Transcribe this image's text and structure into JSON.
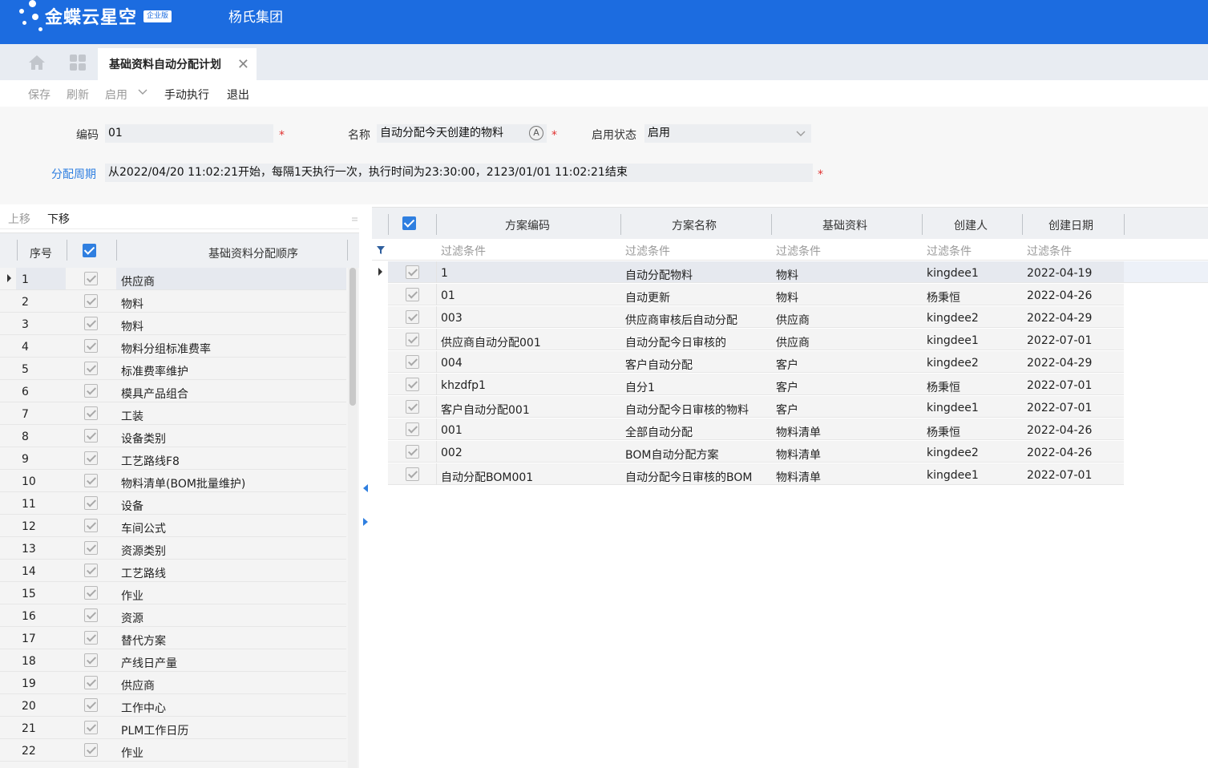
{
  "app": {
    "logo_text": "金蝶云星空",
    "logo_badge": "企业版",
    "company": "杨氏集团"
  },
  "tabs": {
    "active_label": "基础资料自动分配计划",
    "close_glyph": "✕"
  },
  "toolbar": {
    "save": "保存",
    "refresh": "刷新",
    "enable": "启用",
    "manual_run": "手动执行",
    "exit": "退出"
  },
  "form": {
    "code_label": "编码",
    "code_value": "01",
    "name_label": "名称",
    "name_value": "自动分配今天创建的物料",
    "status_label": "启用状态",
    "status_value": "启用",
    "period_label": "分配周期",
    "period_value": "从2022/04/20 11:02:21开始，每隔1天执行一次，执行时间为23:30:00，2123/01/01 11:02:21结束",
    "required_mark": "*",
    "multilang_glyph": "A"
  },
  "left": {
    "move_up": "上移",
    "move_down": "下移",
    "col_seq": "序号",
    "col_name": "基础资料分配顺序",
    "rows": [
      {
        "seq": "1",
        "name": "供应商"
      },
      {
        "seq": "2",
        "name": "物料"
      },
      {
        "seq": "3",
        "name": "物料"
      },
      {
        "seq": "4",
        "name": "物料分组标准费率"
      },
      {
        "seq": "5",
        "name": "标准费率维护"
      },
      {
        "seq": "6",
        "name": "模具产品组合"
      },
      {
        "seq": "7",
        "name": "工装"
      },
      {
        "seq": "8",
        "name": "设备类别"
      },
      {
        "seq": "9",
        "name": "工艺路线F8"
      },
      {
        "seq": "10",
        "name": "物料清单(BOM批量维护)"
      },
      {
        "seq": "11",
        "name": "设备"
      },
      {
        "seq": "12",
        "name": "车间公式"
      },
      {
        "seq": "13",
        "name": "资源类别"
      },
      {
        "seq": "14",
        "name": "工艺路线"
      },
      {
        "seq": "15",
        "name": "作业"
      },
      {
        "seq": "16",
        "name": "资源"
      },
      {
        "seq": "17",
        "name": "替代方案"
      },
      {
        "seq": "18",
        "name": "产线日产量"
      },
      {
        "seq": "19",
        "name": "供应商"
      },
      {
        "seq": "20",
        "name": "工作中心"
      },
      {
        "seq": "21",
        "name": "PLM工作日历"
      },
      {
        "seq": "22",
        "name": "作业"
      }
    ]
  },
  "right": {
    "headers": {
      "code": "方案编码",
      "name": "方案名称",
      "basedata": "基础资料",
      "creator": "创建人",
      "date": "创建日期"
    },
    "filter_label": "过滤条件",
    "rows": [
      {
        "code": "1",
        "name": "自动分配物料",
        "basedata": "物料",
        "creator": "kingdee1",
        "date": "2022-04-19"
      },
      {
        "code": "01",
        "name": "自动更新",
        "basedata": "物料",
        "creator": "杨秉恒",
        "date": "2022-04-26"
      },
      {
        "code": "003",
        "name": "供应商审核后自动分配",
        "basedata": "供应商",
        "creator": "kingdee2",
        "date": "2022-04-29"
      },
      {
        "code": "供应商自动分配001",
        "name": "自动分配今日审核的",
        "basedata": "供应商",
        "creator": "kingdee1",
        "date": "2022-07-01"
      },
      {
        "code": "004",
        "name": "客户自动分配",
        "basedata": "客户",
        "creator": "kingdee2",
        "date": "2022-04-29"
      },
      {
        "code": "khzdfp1",
        "name": "自分1",
        "basedata": "客户",
        "creator": "杨秉恒",
        "date": "2022-07-01"
      },
      {
        "code": "客户自动分配001",
        "name": "自动分配今日审核的物料",
        "basedata": "客户",
        "creator": "kingdee1",
        "date": "2022-07-01"
      },
      {
        "code": "001",
        "name": "全部自动分配",
        "basedata": "物料清单",
        "creator": "杨秉恒",
        "date": "2022-04-26"
      },
      {
        "code": "002",
        "name": "BOM自动分配方案",
        "basedata": "物料清单",
        "creator": "kingdee2",
        "date": "2022-04-26"
      },
      {
        "code": "自动分配BOM001",
        "name": "自动分配今日审核的BOM",
        "basedata": "物料清单",
        "creator": "kingdee1",
        "date": "2022-07-01"
      }
    ]
  },
  "colors": {
    "brand": "#1c6ce0",
    "link": "#2f7fe0",
    "required": "#e0302f"
  }
}
